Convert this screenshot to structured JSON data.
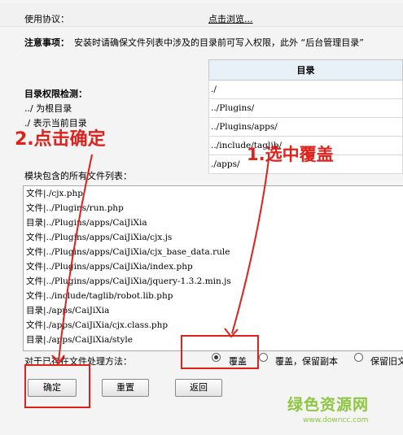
{
  "usage": {
    "label": "使用协议：",
    "link": "点击浏览..."
  },
  "notice": {
    "title": "注意事项：",
    "text": "安装时请确保文件列表中涉及的目录前可写入权限，此外 “后台管理目录”"
  },
  "dir_table": {
    "header": "目录",
    "rows": [
      "./",
      "../Plugins/",
      "../Plugins/apps/",
      "../include/taglib/",
      "./apps/"
    ]
  },
  "permissions": {
    "title": "目录权限检测：",
    "lines": [
      "../  为根目录",
      "./  表示当前目录"
    ]
  },
  "files": {
    "label": "模块包含的所有文件列表：",
    "items": [
      "文件|./cjx.php",
      "文件|../Plugins/run.php",
      "目录|../Plugins/apps/CaiJiXia",
      "文件|../Plugins/apps/CaiJiXia/cjx.js",
      "文件|../Plugins/apps/CaiJiXia/cjx_base_data.rule",
      "文件|../Plugins/apps/CaiJiXia/index.php",
      "文件|../Plugins/apps/CaiJiXia/jquery-1.3.2.min.js",
      "文件|../include/taglib/robot.lib.php",
      "目录|./apps/CaiJiXia",
      "文件|./apps/CaiJiXia/cjx.class.php",
      "目录|./apps/CaiJiXia/style"
    ]
  },
  "method": {
    "label": "对于已存在文件处理方法：",
    "options": [
      "覆盖",
      "覆盖，保留副本",
      "保留旧文"
    ],
    "selected": "覆盖"
  },
  "buttons": {
    "confirm": "确定",
    "reset": "重置",
    "back": "返回"
  },
  "annotations": {
    "step1": "1.选中覆盖",
    "step2": "2.点击确定",
    "color": "#e0201a"
  },
  "watermark": {
    "logo": "绿色资源网",
    "url": "www.downcc.com",
    "color": "#8dc63f"
  }
}
